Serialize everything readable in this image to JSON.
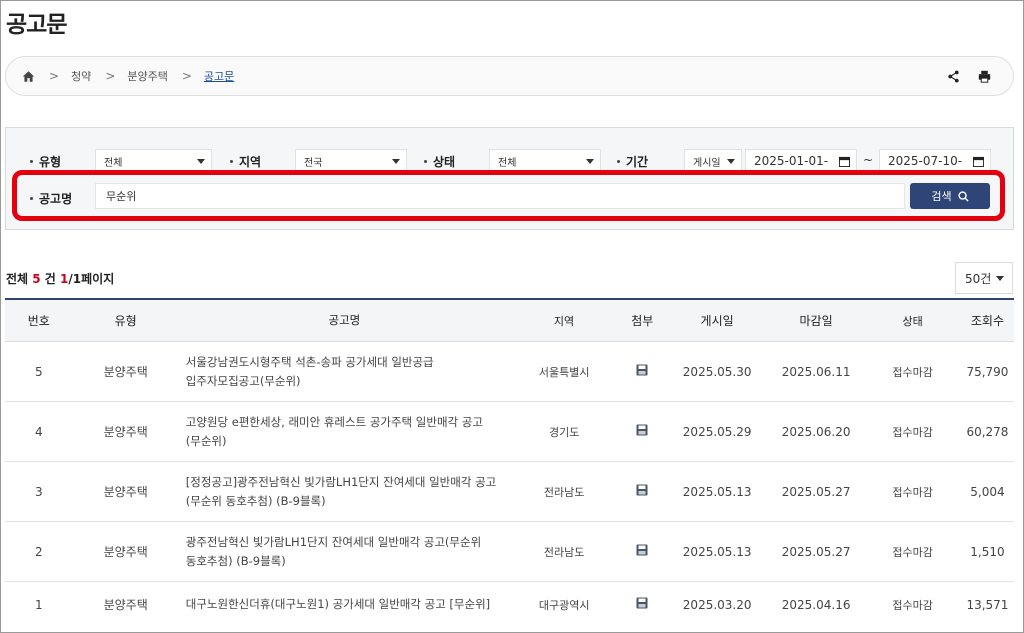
{
  "page": {
    "title": "공고문"
  },
  "breadcrumb": {
    "items": [
      "청약",
      "분양주택"
    ],
    "current": "공고문"
  },
  "filters": {
    "type": {
      "label": "유형",
      "value": "전체"
    },
    "region": {
      "label": "지역",
      "value": "전국"
    },
    "status": {
      "label": "상태",
      "value": "전체"
    },
    "period": {
      "label": "기간",
      "basis": "게시일",
      "start": "2025-01-01-",
      "end": "2025-07-10-",
      "separator": "~"
    },
    "title": {
      "label": "공고명",
      "value": "무순위"
    },
    "search_label": "검색"
  },
  "summary": {
    "prefix": "전체 ",
    "count": "5",
    "unit": " 건 ",
    "current_page": "1",
    "pages": "/1페이지"
  },
  "page_size": "50건",
  "table": {
    "headers": [
      "번호",
      "유형",
      "공고명",
      "지역",
      "첨부",
      "게시일",
      "마감일",
      "상태",
      "조회수"
    ],
    "rows": [
      {
        "no": "5",
        "type": "분양주택",
        "title1": "서울강남권도시형주택 석촌-송파 공가세대 일반공급",
        "title2": "입주자모집공고(무순위)",
        "region": "서울특별시",
        "post": "2025.05.30",
        "due": "2025.06.11",
        "status": "접수마감",
        "views": "75,790"
      },
      {
        "no": "4",
        "type": "분양주택",
        "title1": "고양원당 e편한세상, 래미안 휴레스트 공가주택 일반매각 공고",
        "title2": "(무순위)",
        "region": "경기도",
        "post": "2025.05.29",
        "due": "2025.06.20",
        "status": "접수마감",
        "views": "60,278"
      },
      {
        "no": "3",
        "type": "분양주택",
        "title1": "[정정공고]광주전남혁신 빛가람LH1단지 잔여세대 일반매각 공고",
        "title2": "(무순위 동호추첨) (B-9블록)",
        "region": "전라남도",
        "post": "2025.05.13",
        "due": "2025.05.27",
        "status": "접수마감",
        "views": "5,004"
      },
      {
        "no": "2",
        "type": "분양주택",
        "title1": "광주전남혁신 빛가람LH1단지 잔여세대 일반매각 공고(무순위",
        "title2": "동호추첨) (B-9블록)",
        "region": "전라남도",
        "post": "2025.05.13",
        "due": "2025.05.27",
        "status": "접수마감",
        "views": "1,510"
      },
      {
        "no": "1",
        "type": "분양주택",
        "title1": "대구노원한신더휴(대구노원1) 공가세대 일반매각 공고 [무순위]",
        "title2": "",
        "region": "대구광역시",
        "post": "2025.03.20",
        "due": "2025.04.16",
        "status": "접수마감",
        "views": "13,571"
      }
    ]
  },
  "icons": {
    "home": "home-icon",
    "share": "share-icon",
    "print": "print-icon",
    "search": "search-icon",
    "attachment": "floppy-disk-icon",
    "calendar": "calendar-icon"
  },
  "colors": {
    "accent": "#2f4578",
    "highlight": "#e3000f",
    "count": "#d0021b",
    "link": "#1a4f9c"
  }
}
